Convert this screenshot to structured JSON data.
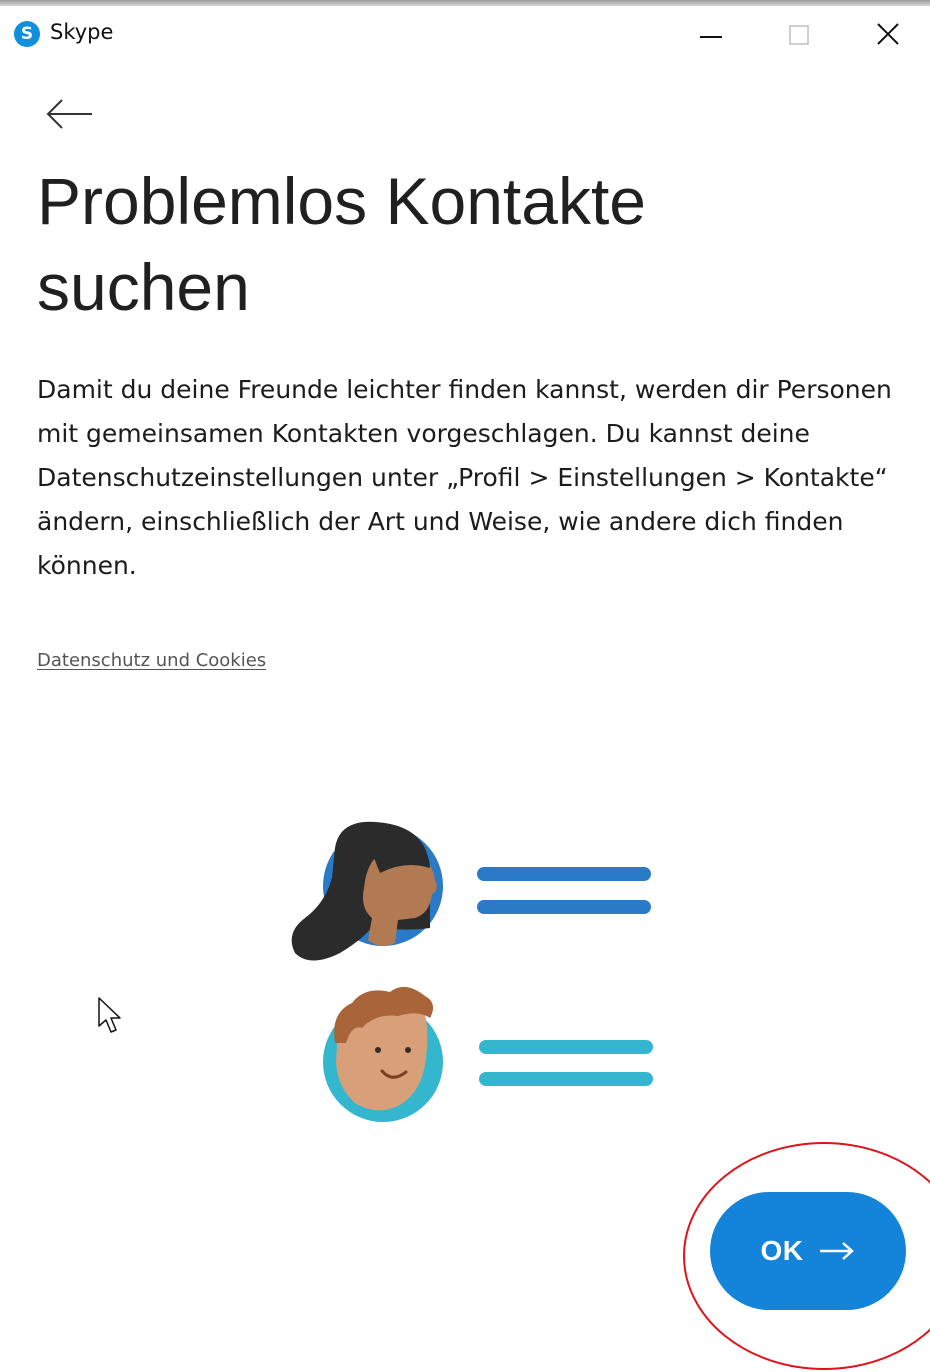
{
  "window": {
    "title": "Skype",
    "logo_letter": "S",
    "controls": [
      "minimize-icon",
      "maximize-icon",
      "close-icon"
    ]
  },
  "navigation": {
    "back_icon": "back-arrow-icon"
  },
  "page": {
    "title_line1": "Problemlos Kontakte",
    "title_line2": "suchen",
    "description": "Damit du deine Freunde leichter finden kannst, werden dir Personen mit gemeinsamen Kontakten vorgeschlagen. Du kannst deine Datenschutzeinstellungen unter „Profil > Einstellungen > Kontakte“ ändern, einschließlich der Art und Weise, wie andere dich finden können.",
    "privacy_link": "Datenschutz und Cookies"
  },
  "illustration": {
    "contacts": [
      {
        "avatar": "woman-avatar-icon",
        "accent": "#2b7ac7"
      },
      {
        "avatar": "man-avatar-icon",
        "accent": "#34b6cf"
      }
    ]
  },
  "primary_action": {
    "label": "OK",
    "icon": "arrow-right-icon",
    "color": "#1384d9"
  },
  "annotation": {
    "highlight_color": "#e0121c"
  },
  "colors": {
    "skype_blue": "#0f8fde",
    "text": "#1c1c1c"
  }
}
